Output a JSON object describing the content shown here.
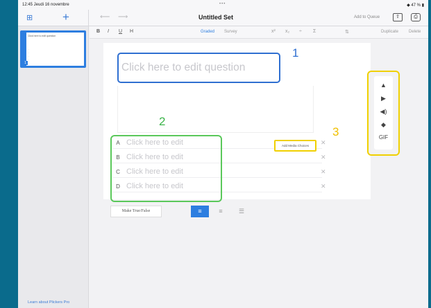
{
  "status_bar": {
    "time_date": "12:45  Jeudi 16 novembre",
    "center": "•••",
    "battery": "47 %"
  },
  "nav": {
    "title": "Untitled Set",
    "add_queue": "Add to Queue",
    "undo_icon": "undo-arrow",
    "redo_icon": "redo-arrow"
  },
  "sidebar": {
    "thumb_title": "Click here to edit question",
    "thumb_number": "1",
    "learn_pro": "Learn about Plickers Pro"
  },
  "toolbar": {
    "bold": "B",
    "italic": "I",
    "underline": "U",
    "heading": "H",
    "graded": "Graded",
    "survey": "Survey",
    "duplicate": "Duplicate",
    "delete": "Delete"
  },
  "question": {
    "placeholder": "Click here to edit question"
  },
  "answers": [
    {
      "letter": "A",
      "text": "Click here to edit"
    },
    {
      "letter": "B",
      "text": "Click here to edit"
    },
    {
      "letter": "C",
      "text": "Click here to edit"
    },
    {
      "letter": "D",
      "text": "Click here to edit"
    }
  ],
  "media_choices_label": "Add Media Choices",
  "media_panel": {
    "gif_label": "GIF"
  },
  "bottom": {
    "true_false": "Make True/False"
  },
  "annotations": {
    "one": "1",
    "two": "2",
    "three": "3"
  },
  "colors": {
    "blue_annotation": "#2f6fd1",
    "green_annotation": "#5ac85a",
    "yellow_annotation": "#f0d000",
    "selected_align": "#2d7ee0"
  }
}
